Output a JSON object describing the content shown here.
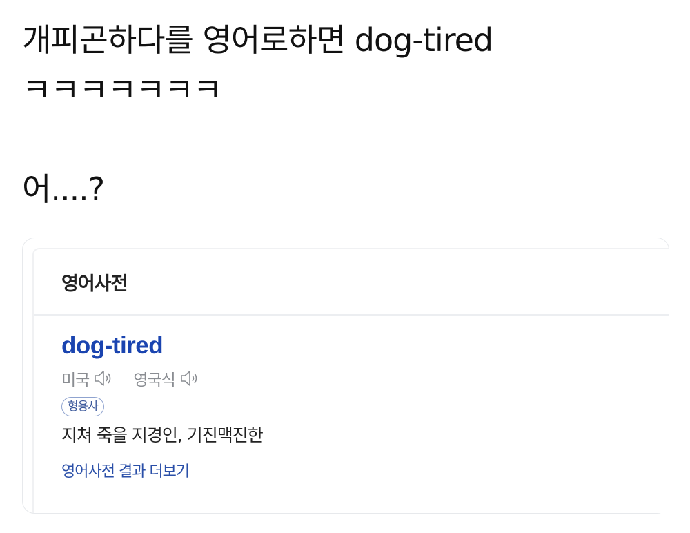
{
  "post": {
    "line1": "개피곤하다를 영어로하면 dog-tired",
    "line2": "ㅋㅋㅋㅋㅋㅋㅋ",
    "line3": "어....?"
  },
  "dictionary_card": {
    "title": "영어사전",
    "word": "dog-tired",
    "pronunciation": {
      "us_label": "미국",
      "uk_label": "영국식",
      "icon": "speaker-icon"
    },
    "part_of_speech": "형용사",
    "meaning": "지쳐 죽을 지경인, 기진맥진한",
    "more_link": "영어사전 결과 더보기",
    "colors": {
      "word": "#1a44b0",
      "link": "#2a4fa8",
      "muted": "#8a8d92"
    }
  }
}
